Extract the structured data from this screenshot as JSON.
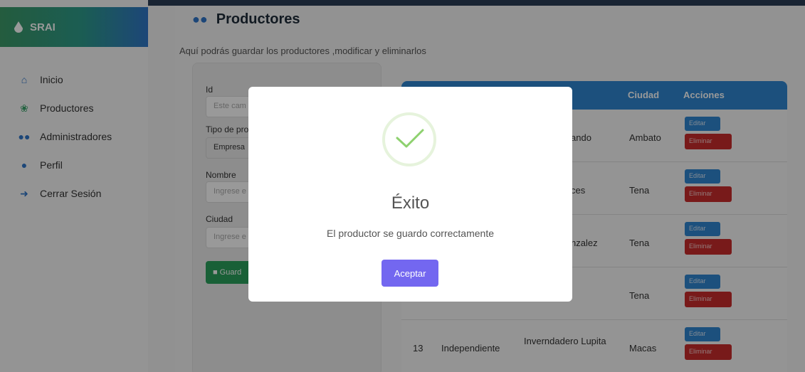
{
  "sidebar": {
    "brand": "SRAI",
    "items": [
      {
        "label": "Inicio",
        "icon": "home-icon"
      },
      {
        "label": "Productores",
        "icon": "seedling-icon"
      },
      {
        "label": "Administradores",
        "icon": "users-icon"
      },
      {
        "label": "Perfil",
        "icon": "user-icon"
      },
      {
        "label": "Cerrar Sesión",
        "icon": "sign-out-icon"
      }
    ]
  },
  "page": {
    "title": "Productores",
    "subtitle": "Aquí podrás guardar los productores ,modificar y eliminarlos"
  },
  "form": {
    "id_label": "Id",
    "id_placeholder": "Este cam",
    "tipo_label": "Tipo de pro",
    "tipo_value": "Empresa",
    "nombre_label": "Nombre",
    "nombre_placeholder": "Ingrese e",
    "ciudad_label": "Ciudad",
    "ciudad_placeholder": "Ingrese e",
    "save_label": "Guard"
  },
  "table": {
    "headers": {
      "ciudad": "Ciudad",
      "acciones": "Acciones"
    },
    "edit_label": "Editar",
    "delete_label": "Eliminar",
    "rows": [
      {
        "id": "",
        "tipo": "",
        "nombre": "ando",
        "ciudad": "Ambato"
      },
      {
        "id": "",
        "tipo": "",
        "nombre": "ces",
        "ciudad": "Tena"
      },
      {
        "id": "",
        "tipo": "",
        "nombre": "nzalez",
        "ciudad": "Tena"
      },
      {
        "id": "",
        "tipo": "",
        "nombre": "",
        "ciudad": "Tena"
      },
      {
        "id": "13",
        "tipo": "Independiente",
        "nombre": "Inverndadero Lupita",
        "ciudad": "Macas"
      }
    ]
  },
  "modal": {
    "title": "Éxito",
    "message": "El productor se guardo correctamente",
    "button": "Aceptar"
  },
  "colors": {
    "accent": "#7367f0",
    "primary": "#2f86d0",
    "danger": "#c82c2c",
    "success": "#2aa05c"
  }
}
